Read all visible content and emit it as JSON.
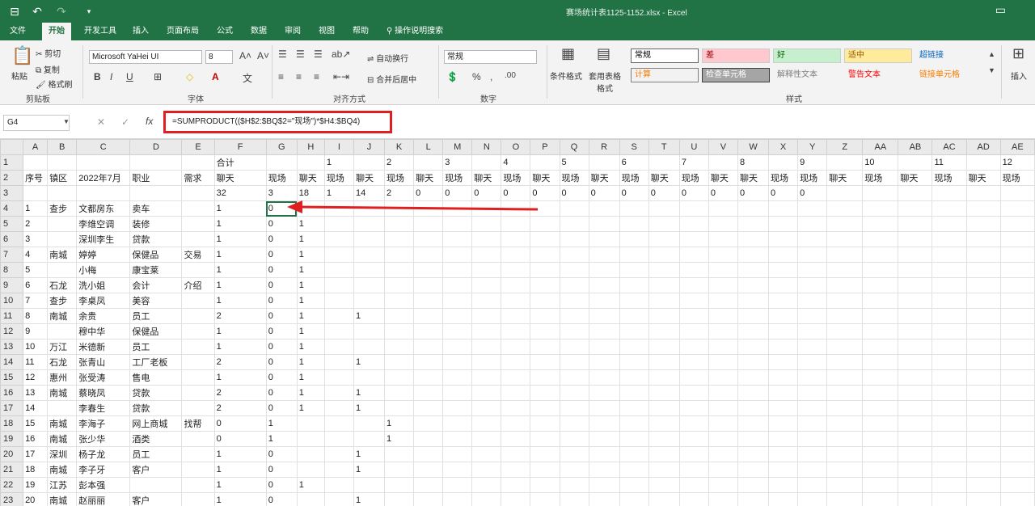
{
  "title": {
    "filename": "赛场统计表1125-1152.xlsx",
    "app": "Excel",
    "quick_access": [
      "⊟",
      "↶",
      "↷",
      "▾"
    ],
    "restore": "▭"
  },
  "menu": {
    "tabs": [
      "文件",
      "开始",
      "开发工具",
      "插入",
      "页面布局",
      "公式",
      "数据",
      "审阅",
      "视图",
      "帮助",
      "操作说明搜索"
    ],
    "active": "开始"
  },
  "ribbon": {
    "clipboard": {
      "paste": "粘贴",
      "cut": "剪切",
      "copy": "复制",
      "format_painter": "格式刷",
      "label": "剪贴板"
    },
    "font": {
      "name": "Microsoft YaHei UI",
      "size": "8",
      "label": "字体",
      "bold": "B",
      "italic": "I",
      "underline": "U"
    },
    "align": {
      "wrap": "自动换行",
      "merge": "合并后居中",
      "label": "对齐方式"
    },
    "number": {
      "format": "常规",
      "label": "数字"
    },
    "styles": {
      "conditional": "条件格式",
      "table": "套用表格格式",
      "label": "样式",
      "cells": [
        {
          "text": "常规",
          "bg": "#ffffff",
          "fg": "#000000",
          "border": "#666666"
        },
        {
          "text": "差",
          "bg": "#ffc7ce",
          "fg": "#9c0006",
          "border": "#cccccc"
        },
        {
          "text": "好",
          "bg": "#c6efce",
          "fg": "#006100",
          "border": "#cccccc"
        },
        {
          "text": "适中",
          "bg": "#ffeb9c",
          "fg": "#9c5700",
          "border": "#cccccc"
        },
        {
          "text": "超链接",
          "bg": "#f3f3f3",
          "fg": "#0563c1",
          "border": "#f3f3f3"
        },
        {
          "text": "计算",
          "bg": "#f2f2f2",
          "fg": "#fa7d00",
          "border": "#7f7f7f"
        },
        {
          "text": "检查单元格",
          "bg": "#a5a5a5",
          "fg": "#ffffff",
          "border": "#3f3f3f"
        },
        {
          "text": "解释性文本",
          "bg": "#f3f3f3",
          "fg": "#7f7f7f",
          "border": "#f3f3f3"
        },
        {
          "text": "警告文本",
          "bg": "#f3f3f3",
          "fg": "#ff0000",
          "border": "#f3f3f3"
        },
        {
          "text": "链接单元格",
          "bg": "#f3f3f3",
          "fg": "#fa7d00",
          "border": "#f3f3f3"
        }
      ]
    },
    "insert": "插入"
  },
  "formula_bar": {
    "name_box": "G4",
    "cancel": "✕",
    "enter": "✓",
    "fx": "fx",
    "formula": "=SUMPRODUCT(($H$2:$BQ$2=\"现场\")*$H4:$BQ4)"
  },
  "grid": {
    "columns": [
      "A",
      "B",
      "C",
      "D",
      "E",
      "F",
      "G",
      "H",
      "I",
      "J",
      "K",
      "L",
      "M",
      "N",
      "O",
      "P",
      "Q",
      "R",
      "S",
      "T",
      "U",
      "V",
      "W",
      "X",
      "Y",
      "Z",
      "AA",
      "AB",
      "AC",
      "AD",
      "AE"
    ],
    "rows": [
      {
        "n": "1",
        "c": {
          "F": "合计",
          "I": "1",
          "K": "2",
          "M": "3",
          "O": "4",
          "Q": "5",
          "S": "6",
          "U": "7",
          "W": "8",
          "Y": "9",
          "AA": "10",
          "AC": "11",
          "AE": "12"
        }
      },
      {
        "n": "2",
        "c": {
          "A": "序号",
          "B": "镇区",
          "C": "2022年7月",
          "D": "职业",
          "E": "需求",
          "F": "聊天",
          "G": "现场",
          "H": "聊天",
          "I": "现场",
          "J": "聊天",
          "K": "现场",
          "L": "聊天",
          "M": "现场",
          "N": "聊天",
          "O": "现场",
          "P": "聊天",
          "Q": "现场",
          "R": "聊天",
          "S": "现场",
          "T": "聊天",
          "U": "现场",
          "V": "聊天",
          "W": "聊天",
          "X": "现场",
          "Y": "现场",
          "Z": "聊天",
          "AA": "现场",
          "AB": "聊天",
          "AC": "现场",
          "AD": "聊天",
          "AE": "现场"
        }
      },
      {
        "n": "3",
        "c": {
          "F": "32",
          "G": "3",
          "H": "18",
          "I": "1",
          "J": "14",
          "K": "2",
          "L": "0",
          "M": "0",
          "N": "0",
          "O": "0",
          "P": "0",
          "Q": "0",
          "R": "0",
          "S": "0",
          "T": "0",
          "U": "0",
          "V": "0",
          "W": "0",
          "X": "0",
          "Y": "0"
        }
      },
      {
        "n": "4",
        "c": {
          "A": "1",
          "B": "查步",
          "C": "文都房东",
          "D": "卖车",
          "F": "1",
          "G": "0"
        }
      },
      {
        "n": "5",
        "c": {
          "A": "2",
          "C": "李维空调",
          "D": "装修",
          "F": "1",
          "G": "0",
          "H": "1"
        }
      },
      {
        "n": "6",
        "c": {
          "A": "3",
          "C": "深圳李生",
          "D": "贷款",
          "F": "1",
          "G": "0",
          "H": "1"
        }
      },
      {
        "n": "7",
        "c": {
          "A": "4",
          "B": "南城",
          "C": "婷婷",
          "D": "保健品",
          "E": "交易",
          "F": "1",
          "G": "0",
          "H": "1"
        }
      },
      {
        "n": "8",
        "c": {
          "A": "5",
          "C": "小梅",
          "D": "康宝莱",
          "F": "1",
          "G": "0",
          "H": "1"
        }
      },
      {
        "n": "9",
        "c": {
          "A": "6",
          "B": "石龙",
          "C": "洗小姐",
          "D": "会计",
          "E": "介绍",
          "F": "1",
          "G": "0",
          "H": "1"
        }
      },
      {
        "n": "10",
        "c": {
          "A": "7",
          "B": "查步",
          "C": "李桌凤",
          "D": "美容",
          "F": "1",
          "G": "0",
          "H": "1"
        }
      },
      {
        "n": "11",
        "c": {
          "A": "8",
          "B": "南城",
          "C": "余贵",
          "D": "员工",
          "F": "2",
          "G": "0",
          "H": "1",
          "J": "1"
        }
      },
      {
        "n": "12",
        "c": {
          "A": "9",
          "C": "穆中华",
          "D": "保健品",
          "F": "1",
          "G": "0",
          "H": "1"
        }
      },
      {
        "n": "13",
        "c": {
          "A": "10",
          "B": "万江",
          "C": "米德新",
          "D": "员工",
          "F": "1",
          "G": "0",
          "H": "1"
        }
      },
      {
        "n": "14",
        "c": {
          "A": "11",
          "B": "石龙",
          "C": "张青山",
          "D": "工厂老板",
          "F": "2",
          "G": "0",
          "H": "1",
          "J": "1"
        }
      },
      {
        "n": "15",
        "c": {
          "A": "12",
          "B": "惠州",
          "C": "张受涛",
          "D": "售电",
          "F": "1",
          "G": "0",
          "H": "1"
        }
      },
      {
        "n": "16",
        "c": {
          "A": "13",
          "B": "南城",
          "C": "蔡晓凤",
          "D": "贷款",
          "F": "2",
          "G": "0",
          "H": "1",
          "J": "1"
        }
      },
      {
        "n": "17",
        "c": {
          "A": "14",
          "C": "李春生",
          "D": "贷款",
          "F": "2",
          "G": "0",
          "H": "1",
          "J": "1"
        }
      },
      {
        "n": "18",
        "c": {
          "A": "15",
          "B": "南城",
          "C": "李海子",
          "D": "网上商城",
          "E": "找帮",
          "F": "0",
          "G": "1",
          "K": "1"
        }
      },
      {
        "n": "19",
        "c": {
          "A": "16",
          "B": "南城",
          "C": "张少华",
          "D": "酒类",
          "F": "0",
          "G": "1",
          "K": "1"
        }
      },
      {
        "n": "20",
        "c": {
          "A": "17",
          "B": "深圳",
          "C": "杨子龙",
          "D": "员工",
          "F": "1",
          "G": "0",
          "J": "1"
        }
      },
      {
        "n": "21",
        "c": {
          "A": "18",
          "B": "南城",
          "C": "李子牙",
          "D": "客户",
          "F": "1",
          "G": "0",
          "J": "1"
        }
      },
      {
        "n": "22",
        "c": {
          "A": "19",
          "B": "江苏",
          "C": "彭本强",
          "F": "1",
          "G": "0",
          "H": "1"
        }
      },
      {
        "n": "23",
        "c": {
          "A": "20",
          "B": "南城",
          "C": "赵丽丽",
          "D": "客户",
          "F": "1",
          "G": "0",
          "J": "1"
        }
      }
    ]
  }
}
